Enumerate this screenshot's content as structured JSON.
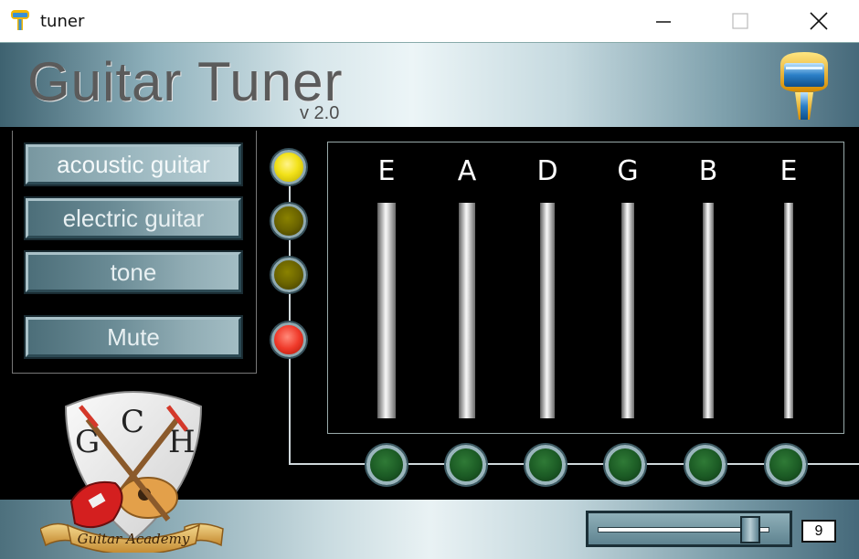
{
  "window": {
    "title": "tuner",
    "controls": {
      "minimize": "minimize-icon",
      "maximize": "maximize-icon",
      "close": "close-icon"
    }
  },
  "header": {
    "heading": "Guitar Tuner",
    "version": "v 2.0",
    "logo_icon": "tuner-logo-icon"
  },
  "modes": [
    {
      "label": "acoustic guitar",
      "active": true
    },
    {
      "label": "electric guitar",
      "active": false
    },
    {
      "label": "tone",
      "active": false
    }
  ],
  "mute_label": "Mute",
  "indicators": [
    {
      "name": "acoustic-indicator",
      "state": "on",
      "color": "#f2e21a"
    },
    {
      "name": "electric-indicator",
      "state": "off",
      "color": "#6b6400"
    },
    {
      "name": "tone-indicator",
      "state": "off",
      "color": "#6b6400"
    },
    {
      "name": "mute-indicator",
      "state": "on",
      "color": "#f03a2a"
    }
  ],
  "strings": [
    {
      "note": "E"
    },
    {
      "note": "A"
    },
    {
      "note": "D"
    },
    {
      "note": "G"
    },
    {
      "note": "B"
    },
    {
      "note": "E"
    }
  ],
  "emblem": {
    "letters": [
      "G",
      "C",
      "H"
    ],
    "ribbon_text": "Guitar Academy"
  },
  "volume": {
    "value": "9",
    "max": 10,
    "level": 0.9
  },
  "colors": {
    "indicator_on": "#f2e21a",
    "indicator_off": "#6b6400",
    "mute_on": "#f03a2a",
    "string_button": "#1b5a24"
  }
}
